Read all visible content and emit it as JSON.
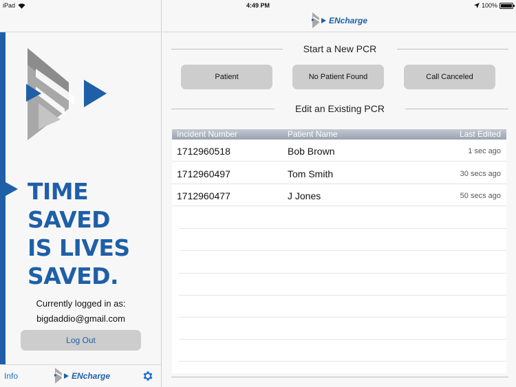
{
  "status_bar": {
    "device": "iPad",
    "time": "4:49 PM",
    "battery": "100%"
  },
  "brand": {
    "name_en": "EN",
    "name_rest": "charge"
  },
  "sidebar": {
    "slogan": [
      "TIME",
      "SAVED",
      "IS LIVES",
      "SAVED."
    ],
    "logged_in_label": "Currently logged in as:",
    "email": "bigdaddio@gmail.com",
    "logout_label": "Log Out",
    "info_label": "Info"
  },
  "main": {
    "new_section_title": "Start a New PCR",
    "buttons": [
      "Patient",
      "No Patient Found",
      "Call Canceled"
    ],
    "existing_section_title": "Edit an Existing PCR",
    "table": {
      "headers": [
        "Incident Number",
        "Patient Name",
        "Last Edited"
      ],
      "rows": [
        [
          "1712960518",
          "Bob Brown",
          "1 sec ago"
        ],
        [
          "1712960497",
          "Tom Smith",
          "30 secs ago"
        ],
        [
          "1712960477",
          "J Jones",
          "50 secs ago"
        ]
      ]
    }
  },
  "colors": {
    "brand_blue": "#1f5fa8",
    "logo_gray": "#9a9a9a",
    "link_blue": "#1f6ed1"
  },
  "icons": [
    "wifi-icon",
    "location-arrow-icon",
    "battery-icon",
    "gear-icon",
    "encharge-logo-icon"
  ]
}
